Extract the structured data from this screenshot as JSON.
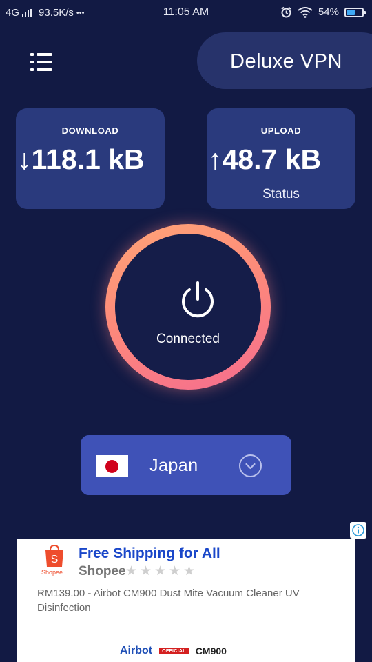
{
  "status_bar": {
    "network": "4G",
    "speed": "93.5K/s",
    "more": "•••",
    "time": "11:05 AM",
    "battery_pct": "54%",
    "battery_level": 0.54,
    "icons": [
      "signal-icon",
      "alarm-icon",
      "wifi-icon",
      "battery-icon"
    ]
  },
  "header": {
    "menu_icon": "list-menu-icon",
    "app_title": "Deluxe VPN"
  },
  "download": {
    "label": "DOWNLOAD",
    "value": "↓118.1 kB"
  },
  "upload": {
    "label": "UPLOAD",
    "value": "↑48.7 kB",
    "sub": "Status"
  },
  "connection": {
    "state": "Connected",
    "icon": "power-icon"
  },
  "country": {
    "name": "Japan",
    "flag": "japan-flag-icon",
    "expand_icon": "chevron-down-icon"
  },
  "ad": {
    "info_icon": "info-icon",
    "advertiser_logo_text": "Shopee",
    "headline": "Free Shipping for All",
    "brand": "Shopee",
    "rating_stars": 5,
    "description": "RM139.00 - Airbot CM900 Dust Mite Vacuum Cleaner UV Disinfection",
    "product_brand": "Airbot",
    "badge": "OFFICIAL",
    "product_model": "CM900"
  },
  "colors": {
    "background": "#121a44",
    "card": "#2a3a7d",
    "title_pill": "#27336b",
    "country_select": "#3f52b7",
    "ring_start": "#ffa577",
    "ring_end": "#f56d8f",
    "ad_headline": "#1a47c9",
    "shopee": "#ee4d2d"
  }
}
